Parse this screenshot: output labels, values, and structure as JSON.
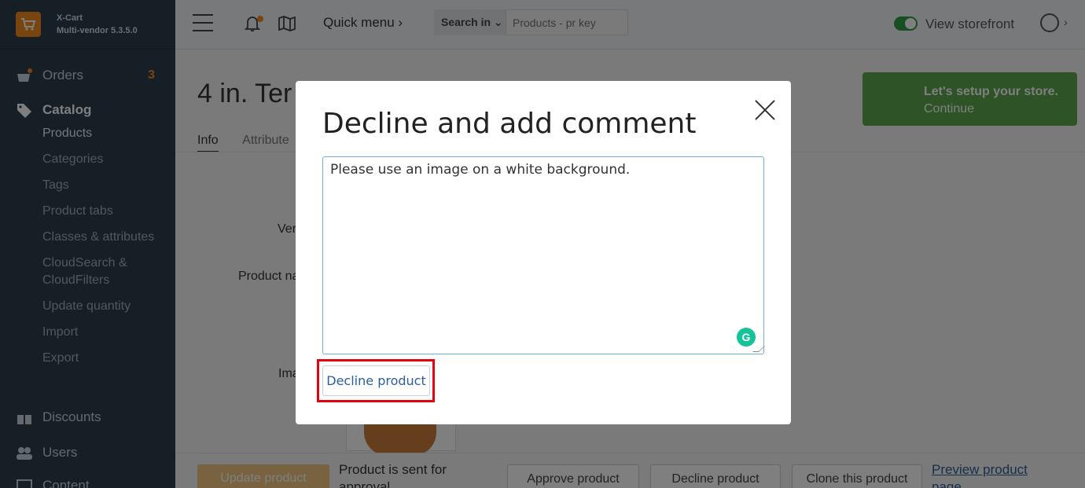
{
  "brand": {
    "name": "X-Cart",
    "version": "Multi-vendor 5.3.5.0"
  },
  "sidebar": {
    "orders": {
      "label": "Orders",
      "count": "3"
    },
    "catalog": {
      "label": "Catalog"
    },
    "catalog_items": [
      "Products",
      "Categories",
      "Tags",
      "Product tabs",
      "Classes & attributes",
      "CloudSearch &",
      "CloudFilters",
      "Update quantity",
      "Import",
      "Export"
    ],
    "discounts": "Discounts",
    "users": "Users",
    "content": "Content"
  },
  "topbar": {
    "quick_menu": "Quick menu ›",
    "search_in": "Search in ⌄",
    "search_placeholder": "Products - pr key",
    "view_storefront": "View storefront",
    "avatar_chevron": "›"
  },
  "page": {
    "title": "4 in. Ter",
    "tabs": [
      "Info",
      "Attribute"
    ],
    "setup_line1": "Let's setup your store.",
    "setup_line2": "Continue",
    "field_vendor": "Ver",
    "field_name": "Product na",
    "field_image": "Ima"
  },
  "footer": {
    "update_product": "Update product",
    "sent_text_1": "Product is sent for",
    "sent_text_2": "approval",
    "approve": "Approve product",
    "decline": "Decline product",
    "clone": "Clone this product",
    "preview_1": "Preview product",
    "preview_2": "page"
  },
  "modal": {
    "title": "Decline and add comment",
    "comment_value": "Please use an image on a white background. ",
    "grammarly": "G",
    "decline_button": "Decline product"
  },
  "colors": {
    "accent": "#f08a1c",
    "sidebar": "#2d3f4d",
    "highlight": "#e3000f",
    "success": "#5ba64d"
  }
}
